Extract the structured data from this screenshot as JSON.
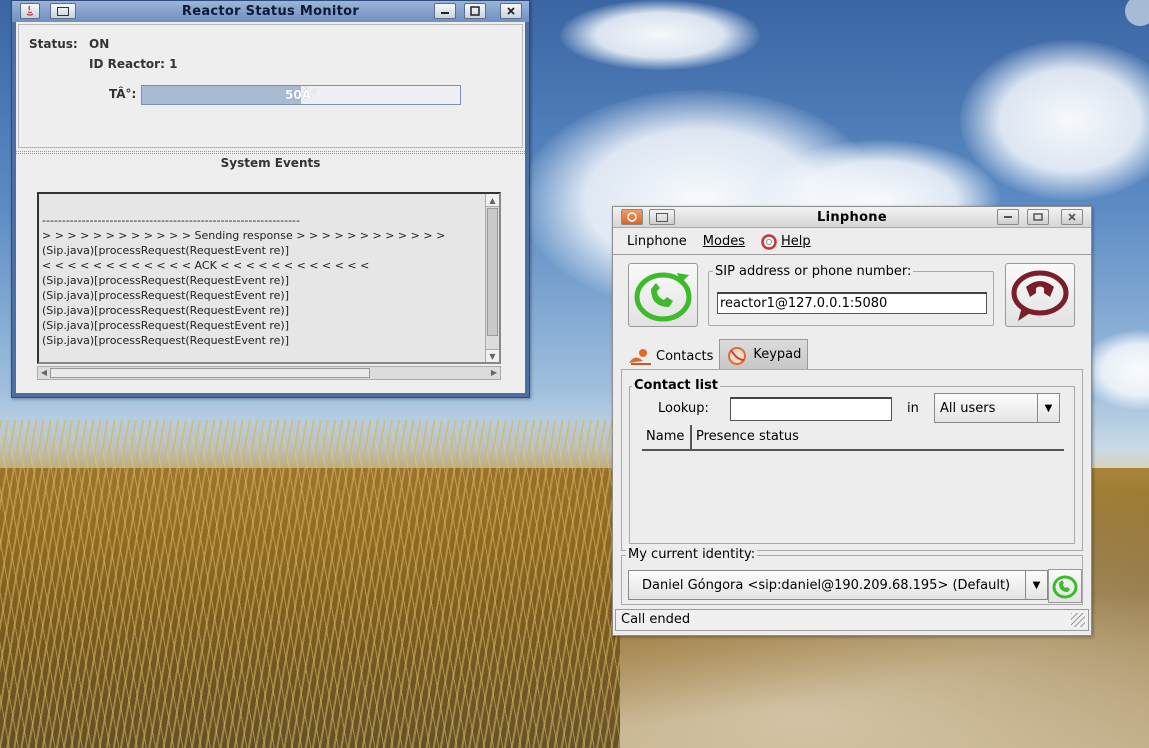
{
  "desktop": {},
  "reactor_window": {
    "title": "Reactor Status Monitor",
    "status_label": "Status:",
    "status_value": "ON",
    "id_label": "ID Reactor: 1",
    "temp_label": "TÂ°:",
    "progress_text": "50Â°",
    "progress_fraction": 0.5,
    "events_title": "System Events",
    "events": [
      "",
      "-----------------------------------------------------------------",
      "> > > > > > > > > > > > Sending response > > > > > > > > > > > >",
      "(Sip.java)[processRequest(RequestEvent re)]",
      "< < < < < < < < < < < < ACK < < < < < < < < < < < <",
      "(Sip.java)[processRequest(RequestEvent re)]",
      "(Sip.java)[processRequest(RequestEvent re)]",
      "(Sip.java)[processRequest(RequestEvent re)]",
      "(Sip.java)[processRequest(RequestEvent re)]",
      "(Sip.java)[processRequest(RequestEvent re)]"
    ]
  },
  "linphone_window": {
    "title": "Linphone",
    "menu": [
      "Linphone",
      "Modes",
      "Help"
    ],
    "sip_legend": "SIP address or phone number:",
    "sip_value": "reactor1@127.0.0.1:5080",
    "tabs": [
      "Contacts",
      "Keypad"
    ],
    "contact_list_title": "Contact list",
    "lookup_label": "Lookup:",
    "lookup_value": "",
    "in_label": "in",
    "filter_value": "All users",
    "columns": [
      "Name",
      "Presence status"
    ],
    "identity_legend": "My current identity:",
    "identity_value": "Daniel Góngora <sip:daniel@190.209.68.195> (Default)",
    "status_text": "Call ended"
  },
  "colors": {
    "call_green": "#3dbb2a",
    "hangup_maroon": "#7a1f2a",
    "progress_fill": "#a8bbd5"
  }
}
